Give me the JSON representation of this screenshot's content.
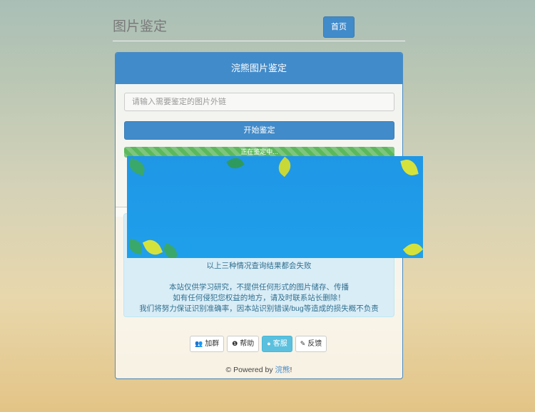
{
  "header": {
    "site_title": "图片鉴定",
    "home_label": "首页"
  },
  "panel": {
    "title": "浣熊图片鉴定",
    "input_placeholder": "请输入需要鉴定的图片外链",
    "input_value": "",
    "start_label": "开始鉴定",
    "progress": {
      "text": "正在鉴定中...",
      "percent": 100
    }
  },
  "info": {
    "line1": "以上三种情况查询结果都会失败",
    "para": [
      "本站仅供学习研究，不提供任何形式的图片储存、传播",
      "如有任何侵犯您权益的地方，请及时联系站长删除！",
      "我们将努力保证识别准确率，因本站识别错误/bug等造成的损失概不负责"
    ]
  },
  "buttons": [
    {
      "icon": "users-icon",
      "label": "加群"
    },
    {
      "icon": "help-icon",
      "label": "帮助"
    },
    {
      "icon": "user-icon",
      "label": "客服"
    },
    {
      "icon": "pencil-icon",
      "label": "反馈"
    }
  ],
  "footer": {
    "prefix": "© Powered by ",
    "link": "浣熊",
    "suffix": "!"
  },
  "colors": {
    "primary": "#428bca",
    "success": "#5cb85c",
    "info_bg": "#d9edf7",
    "info_text": "#31708f",
    "overlay": "#1f9fea"
  }
}
